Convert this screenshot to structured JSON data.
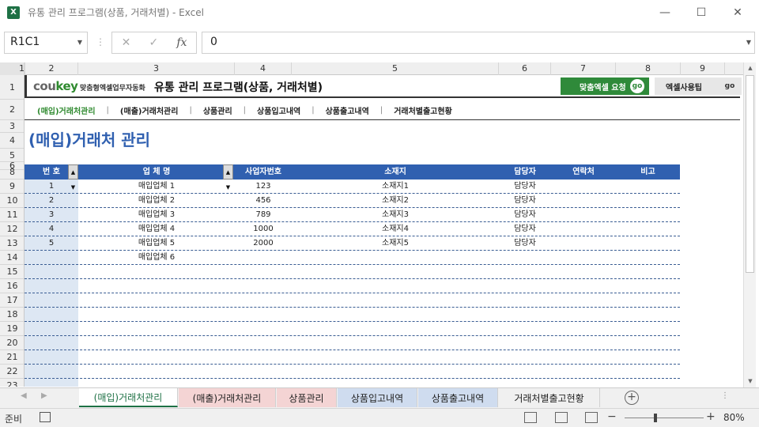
{
  "window": {
    "app_icon": "X",
    "title": "유통 관리 프로그램(상품, 거래처별) - Excel"
  },
  "formula": {
    "cell_ref": "R1C1",
    "fx": "fx",
    "value": "0"
  },
  "columns": [
    "1",
    "2",
    "3",
    "4",
    "5",
    "6",
    "7",
    "8",
    "9"
  ],
  "rows": [
    "1",
    "2",
    "3",
    "4",
    "5",
    "6",
    "8",
    "9",
    "10",
    "11",
    "12",
    "13",
    "14",
    "15",
    "16",
    "17",
    "18",
    "19",
    "20",
    "21",
    "22",
    "23"
  ],
  "banner": {
    "logo_a": "cou",
    "logo_b": "key",
    "brand": "맞춤형엑셀업무자동화",
    "title": "유통 관리 프로그램(상품, 거래처별)",
    "request_btn": "맞춤엑셀 요청",
    "tips_btn": "엑셀사용팁",
    "go": "go"
  },
  "nav": [
    "(매입)거래처관리",
    "(매출)거래처관리",
    "상품관리",
    "상품입고내역",
    "상품출고내역",
    "거래처별출고현황"
  ],
  "page_title": "(매입)거래처 관리",
  "table": {
    "headers": [
      "번 호",
      "업 체 명",
      "사업자번호",
      "소재지",
      "담당자",
      "연락처",
      "비고"
    ],
    "rows": [
      [
        "1",
        "매입업체 1",
        "123",
        "소재지1",
        "담당자"
      ],
      [
        "2",
        "매입업체 2",
        "456",
        "소재지2",
        "담당자"
      ],
      [
        "3",
        "매입업체 3",
        "789",
        "소재지3",
        "담당자"
      ],
      [
        "4",
        "매입업체 4",
        "1000",
        "소재지4",
        "담당자"
      ],
      [
        "5",
        "매입업체 5",
        "2000",
        "소재지5",
        "담당자"
      ],
      [
        "",
        "매입업체 6",
        "",
        "",
        ""
      ]
    ]
  },
  "sheet_tabs": [
    {
      "label": "(매입)거래처관리",
      "color": "#ffffff"
    },
    {
      "label": "(매출)거래처관리",
      "color": "#f4d4d4"
    },
    {
      "label": "상품관리",
      "color": "#f4d4d4"
    },
    {
      "label": "상품입고내역",
      "color": "#cfdcef"
    },
    {
      "label": "상품출고내역",
      "color": "#cfdcef"
    },
    {
      "label": "거래처별출고현황",
      "color": "#f0f0f0"
    }
  ],
  "status": {
    "ready": "준비",
    "zoom": "80%",
    "zoom_minus": "−",
    "zoom_plus": "+"
  },
  "icons": {
    "close": "close-icon",
    "minimize": "minimize-icon",
    "maximize": "maximize-icon"
  }
}
